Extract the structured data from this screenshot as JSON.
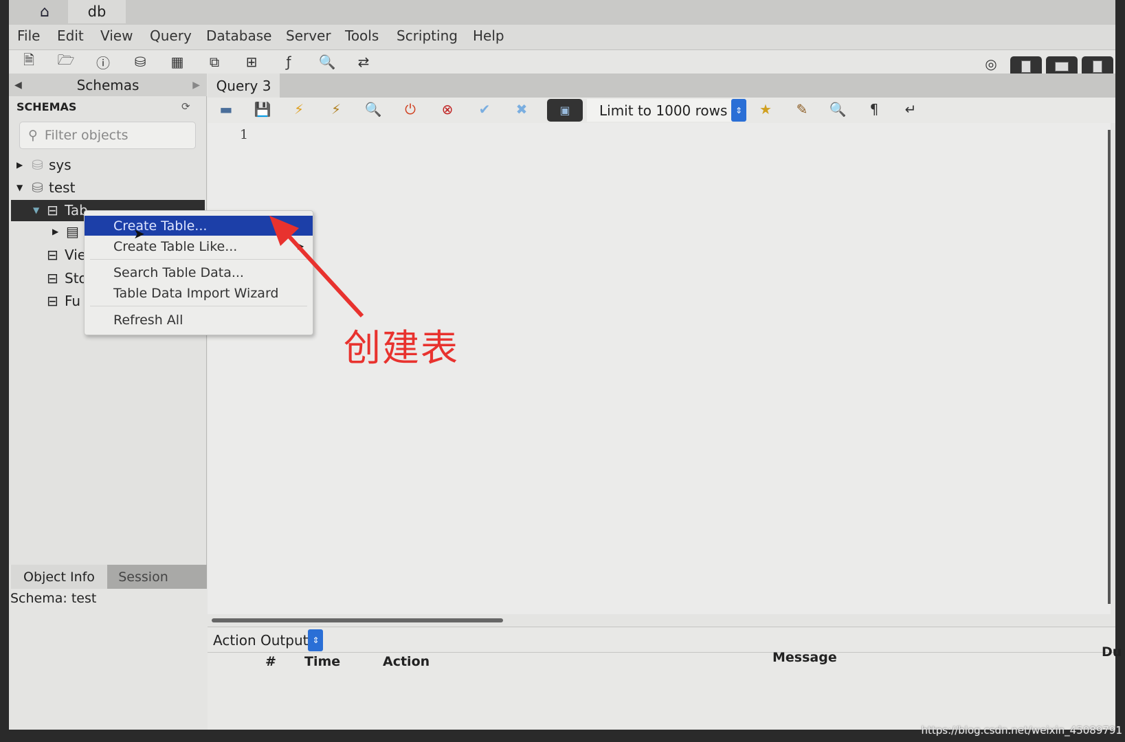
{
  "titlebar": {
    "home_icon": "home-icon",
    "tab": "db"
  },
  "menu": [
    "File",
    "Edit",
    "View",
    "Query",
    "Database",
    "Server",
    "Tools",
    "Scripting",
    "Help"
  ],
  "sidebar": {
    "title": "Schemas",
    "section": "SCHEMAS",
    "filter_placeholder": "Filter objects",
    "tree": [
      {
        "label": "sys",
        "expanded": false
      },
      {
        "label": "test",
        "expanded": true
      },
      {
        "label": "Tables",
        "selected": true
      },
      {
        "label": ""
      },
      {
        "label": "Views"
      },
      {
        "label": "Stored Procedures"
      },
      {
        "label": "Functions"
      }
    ],
    "tree_visible": [
      "sys",
      "test",
      "Tab",
      "",
      "Vie",
      "Sto",
      "Fu"
    ],
    "bottom_tabs": [
      "Object Info",
      "Session"
    ],
    "info": "Schema: test"
  },
  "context_menu": {
    "items": [
      "Create Table...",
      "Create Table Like...",
      "Search Table Data...",
      "Table Data Import Wizard",
      "Refresh All"
    ],
    "highlighted": "Create Table...",
    "highlight_color": "#1c3fa8"
  },
  "annotation": {
    "text": "创建表",
    "color": "#e8322e"
  },
  "query": {
    "tab": "Query 3",
    "limit": "Limit to 1000 rows",
    "line_number": "1"
  },
  "output": {
    "selector": "Action Output",
    "columns": [
      "#",
      "Time",
      "Action",
      "Message",
      "Du"
    ]
  },
  "watermark": "https://blog.csdn.net/weixin_45089791"
}
